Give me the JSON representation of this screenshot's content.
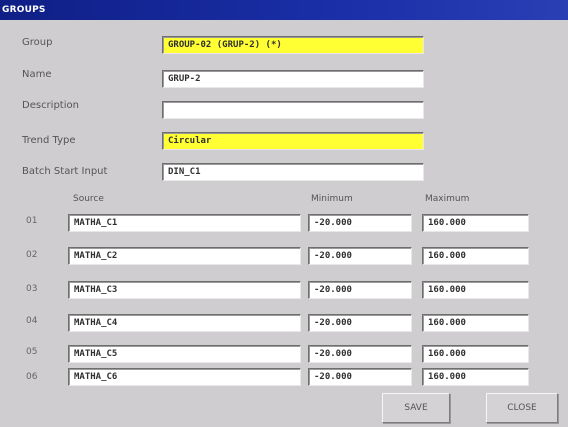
{
  "window": {
    "title": "GROUPS"
  },
  "form": {
    "group": {
      "label": "Group",
      "value": "GROUP-02 (GRUP-2) (*)"
    },
    "name": {
      "label": "Name",
      "value": "GRUP-2"
    },
    "description": {
      "label": "Description",
      "value": ""
    },
    "trend_type": {
      "label": "Trend Type",
      "value": "Circular"
    },
    "batch_start_input": {
      "label": "Batch Start Input",
      "value": "DIN_C1"
    }
  },
  "sources": {
    "headers": {
      "source": "Source",
      "minimum": "Minimum",
      "maximum": "Maximum"
    },
    "rows": [
      {
        "num": "01",
        "source": "MATHA_C1",
        "minimum": "-20.000",
        "maximum": "160.000"
      },
      {
        "num": "02",
        "source": "MATHA_C2",
        "minimum": "-20.000",
        "maximum": "160.000"
      },
      {
        "num": "03",
        "source": "MATHA_C3",
        "minimum": "-20.000",
        "maximum": "160.000"
      },
      {
        "num": "04",
        "source": "MATHA_C4",
        "minimum": "-20.000",
        "maximum": "160.000"
      },
      {
        "num": "05",
        "source": "MATHA_C5",
        "minimum": "-20.000",
        "maximum": "160.000"
      },
      {
        "num": "06",
        "source": "MATHA_C6",
        "minimum": "-20.000",
        "maximum": "160.000"
      }
    ]
  },
  "buttons": {
    "save": "SAVE",
    "close": "CLOSE"
  },
  "colors": {
    "titlebar": "#1a2fa8",
    "highlight_field": "#ffff33",
    "window_bg": "#cfcdd0"
  }
}
